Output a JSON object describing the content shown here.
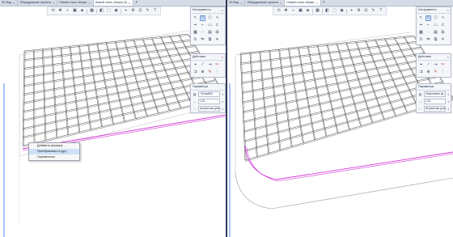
{
  "left_pane": {
    "tabs": [
      {
        "label": "3D Вид",
        "active": false
      },
      {
        "label": "Оборудование проекта",
        "active": false
      },
      {
        "label": "Новый стиль сборки",
        "active": false
      },
      {
        "label": "Новый стиль сборки (3)",
        "active": true
      }
    ],
    "tools_panel": {
      "title": "Инструменты"
    },
    "actions_panel": {
      "title": "Действия"
    },
    "params_panel": {
      "title": "Параметры",
      "fields": [
        {
          "icon": "layer-icon",
          "value": "+30 мм900"
        },
        {
          "icon": "dimension-icon",
          "value": "1,00"
        },
        {
          "icon": "spacing-icon",
          "value": "Актуальная длина"
        }
      ]
    },
    "context_menu": {
      "items": [
        {
          "label": "Добавить вершину",
          "highlighted": false
        },
        {
          "label": "Преобразовать в дугу",
          "highlighted": true
        },
        {
          "label": "Переместить",
          "highlighted": false
        }
      ]
    }
  },
  "right_pane": {
    "tabs": [
      {
        "label": "3D Вид",
        "active": false
      },
      {
        "label": "Оборудование проекта",
        "active": false
      },
      {
        "label": "Новый стиль сборки",
        "active": true
      }
    ],
    "tools_panel": {
      "title": "Инструменты"
    },
    "actions_panel": {
      "title": "Действия"
    },
    "params_panel": {
      "title": "Параметры",
      "fields": [
        {
          "icon": "layer-icon",
          "value": "Заполнение ар..."
        },
        {
          "icon": "dimension-icon",
          "value": "1,00"
        },
        {
          "icon": "spacing-icon",
          "value": "Актуальная длина"
        }
      ]
    }
  },
  "toolbar_icons": [
    "orbit-icon",
    "pan-icon",
    "zoom-icon",
    "fit-icon",
    "view-icon",
    "sep",
    "display-icon",
    "sep",
    "section-icon",
    "select-icon",
    "visibility-icon",
    "sep",
    "snap-icon",
    "settings-icon",
    "measure-icon",
    "annotate-icon",
    "help-icon"
  ],
  "colors": {
    "rebar": "#4a4a4a",
    "selected_rebar": "#d03cd3",
    "axis": "#2a6de0",
    "divider": "#2b3a55"
  }
}
